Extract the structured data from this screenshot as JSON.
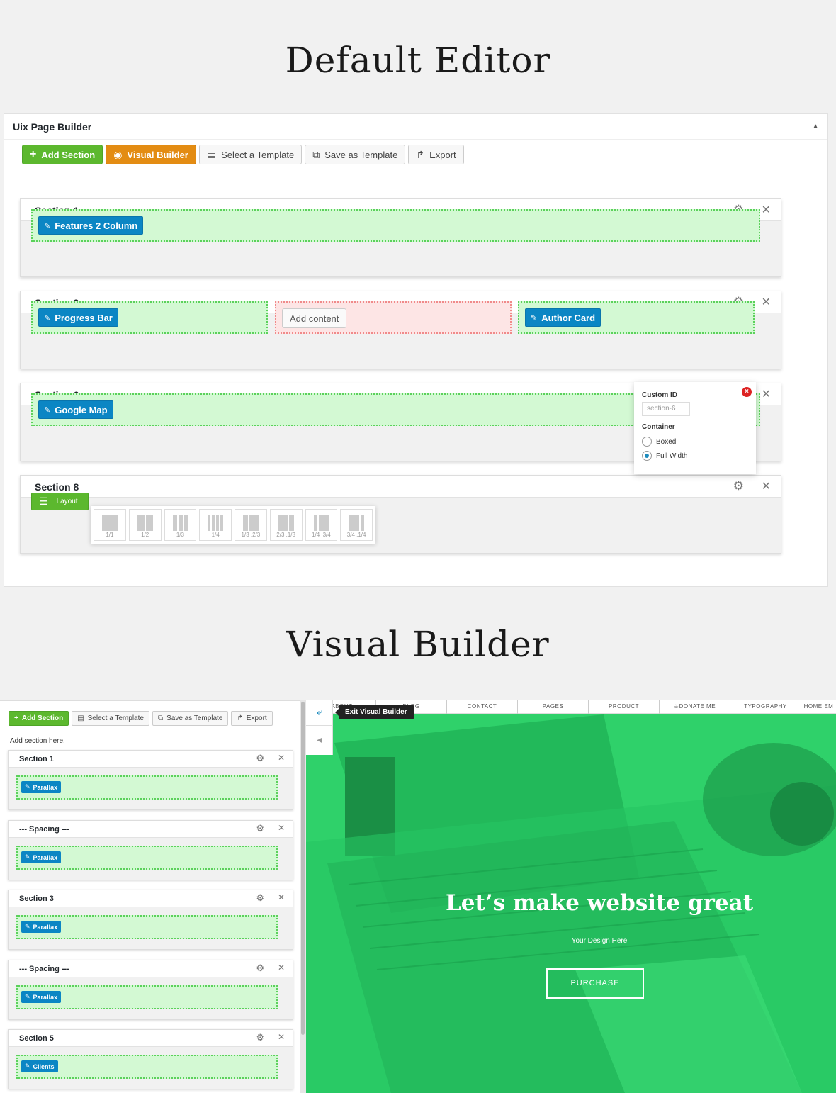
{
  "headings": {
    "default_editor": "Default Editor",
    "visual_builder": "Visual Builder"
  },
  "panel": {
    "title": "Uix Page Builder",
    "toggle_icon": "triangle-up-icon"
  },
  "toolbar": {
    "add_section": "Add Section",
    "visual_builder": "Visual Builder",
    "select_template": "Select a Template",
    "save_template": "Save as Template",
    "export": "Export"
  },
  "sections": [
    {
      "title": "Section 1",
      "modules": [
        "Features 2 Column"
      ]
    },
    {
      "title": "Section 2",
      "modules": [
        "Progress Bar",
        "Author Card"
      ],
      "empty_label": "Add content"
    },
    {
      "title": "Section 6",
      "modules": [
        "Google Map"
      ]
    },
    {
      "title": "Section 8",
      "layout_label": "Layout"
    }
  ],
  "settings_popover": {
    "custom_id_label": "Custom ID",
    "custom_id_value": "section-6",
    "container_label": "Container",
    "options": [
      "Boxed",
      "Full Width"
    ],
    "selected": "Full Width"
  },
  "layout_options": [
    "1/1",
    "1/2",
    "1/3",
    "1/4",
    "1/3 ,2/3",
    "2/3 ,1/3",
    "1/4 ,3/4",
    "3/4 ,1/4"
  ],
  "vb": {
    "toolbar": {
      "add_section": "Add Section",
      "select_template": "Select a Template",
      "save_template": "Save as Template",
      "export": "Export"
    },
    "hint": "Add section here.",
    "sections": [
      {
        "title": "Section 1",
        "module": "Parallax"
      },
      {
        "title": "--- Spacing ---",
        "module": "Parallax"
      },
      {
        "title": "Section 3",
        "module": "Parallax"
      },
      {
        "title": "--- Spacing ---",
        "module": "Parallax"
      },
      {
        "title": "Section 5",
        "module": "Clients"
      }
    ],
    "nav": [
      "ABOUT",
      "BLOG",
      "CONTACT",
      "PAGES",
      "PRODUCT",
      "☕DONATE ME",
      "TYPOGRAPHY",
      "HOME EM"
    ],
    "exit_tooltip": "Exit Visual Builder",
    "hero_title": "Let’s make website great",
    "hero_sub": "Your Design Here",
    "hero_button": "PURCHASE"
  },
  "colors": {
    "green": "#5cb82e",
    "orange": "#e38c13",
    "blue_chip": "#0b86c4",
    "hero": "#2fd16a"
  }
}
